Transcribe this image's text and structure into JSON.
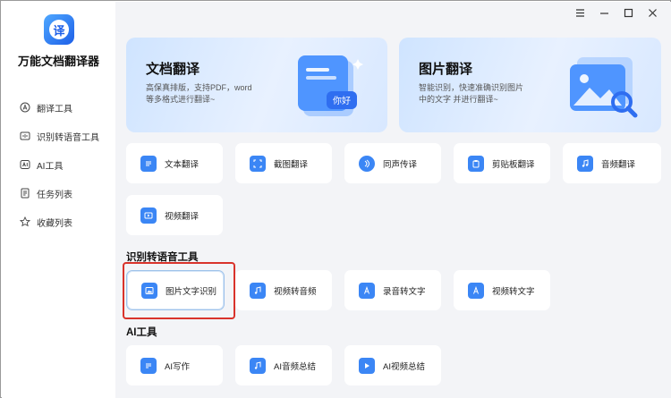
{
  "app": {
    "title": "万能文档翻译器",
    "logo_char": "译"
  },
  "sidebar": {
    "items": [
      {
        "label": "翻译工具",
        "icon": "translate-icon"
      },
      {
        "label": "识别转语音工具",
        "icon": "speech-icon"
      },
      {
        "label": "AI工具",
        "icon": "ai-icon"
      },
      {
        "label": "任务列表",
        "icon": "task-list-icon"
      },
      {
        "label": "收藏列表",
        "icon": "star-icon"
      }
    ]
  },
  "banners": [
    {
      "title": "文档翻译",
      "desc_line1": "高保真排版，支持PDF，word",
      "desc_line2": "等多格式进行翻译~",
      "art_text": "你好"
    },
    {
      "title": "图片翻译",
      "desc_line1": "智能识别，快速准确识别图片",
      "desc_line2": "中的文字 并进行翻译~"
    }
  ],
  "translate_tools": [
    "文本翻译",
    "截图翻译",
    "同声传译",
    "剪贴板翻译",
    "音频翻译",
    "视频翻译"
  ],
  "recognition_section": {
    "title": "识别转语音工具",
    "tools": [
      "图片文字识别",
      "视频转音频",
      "录音转文字",
      "视频转文字"
    ]
  },
  "ai_section": {
    "title": "AI工具",
    "tools": [
      "AI写作",
      "AI音频总结",
      "AI视频总结"
    ]
  },
  "colors": {
    "accent": "#2f7cf6",
    "highlight": "#d9332b",
    "background": "#f3f4f7"
  }
}
